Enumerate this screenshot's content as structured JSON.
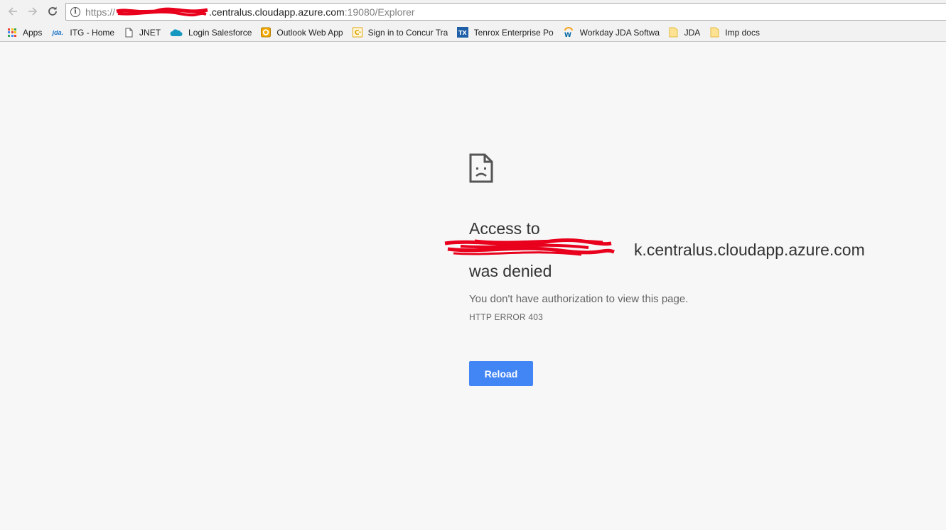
{
  "toolbar": {
    "url_scheme": "https://",
    "url_host_visible": ".centralus.cloudapp.azure.com",
    "url_path": ":19080/Explorer"
  },
  "bookmarks": [
    {
      "label": "Apps",
      "icon": "apps-grid-icon"
    },
    {
      "label": "ITG - Home",
      "icon": "jda-logo-icon"
    },
    {
      "label": "JNET",
      "icon": "page-icon"
    },
    {
      "label": "Login Salesforce",
      "icon": "salesforce-cloud-icon"
    },
    {
      "label": "Outlook Web App",
      "icon": "outlook-icon"
    },
    {
      "label": "Sign in to Concur Tra",
      "icon": "concur-icon"
    },
    {
      "label": "Tenrox Enterprise Por",
      "icon": "tenrox-icon"
    },
    {
      "label": "Workday JDA Softwar",
      "icon": "workday-icon"
    },
    {
      "label": "JDA",
      "icon": "folder-icon"
    },
    {
      "label": "Imp docs",
      "icon": "folder-icon"
    }
  ],
  "error": {
    "line1": "Access to",
    "host_visible": "k.centralus.cloudapp.azure.com",
    "line3": "was denied",
    "message": "You don't have authorization to view this page.",
    "code": "HTTP ERROR 403",
    "reload_label": "Reload"
  },
  "colors": {
    "accent": "#4285f4",
    "redaction": "#e8001c"
  }
}
